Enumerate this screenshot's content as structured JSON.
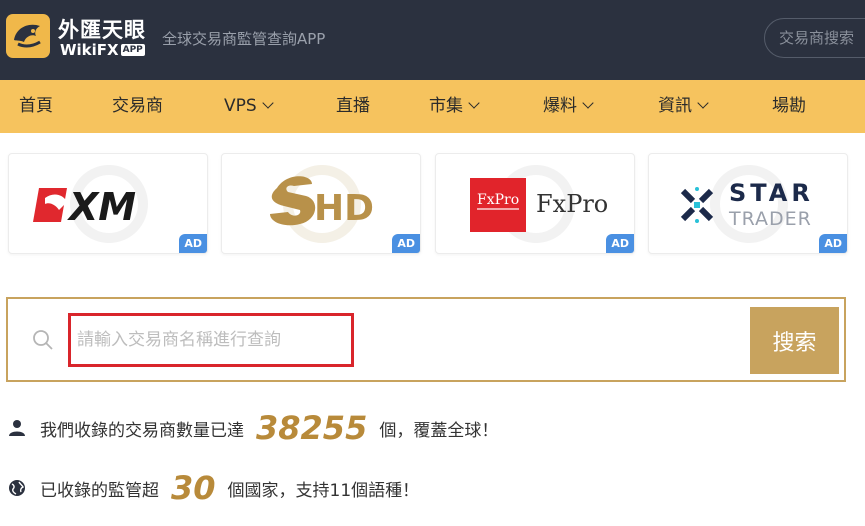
{
  "header": {
    "logo_cn": "外匯天眼",
    "logo_en": "WikiFX",
    "logo_app_badge": "APP",
    "tagline": "全球交易商監管查詢APP",
    "search_button_label": "交易商搜索"
  },
  "nav": {
    "items": [
      {
        "label": "首頁",
        "has_dropdown": false
      },
      {
        "label": "交易商",
        "has_dropdown": false
      },
      {
        "label": "VPS",
        "has_dropdown": true
      },
      {
        "label": "直播",
        "has_dropdown": false
      },
      {
        "label": "市集",
        "has_dropdown": true
      },
      {
        "label": "爆料",
        "has_dropdown": true
      },
      {
        "label": "資訊",
        "has_dropdown": true
      },
      {
        "label": "場勘",
        "has_dropdown": false
      }
    ]
  },
  "ads": [
    {
      "brand": "XM",
      "badge": "AD"
    },
    {
      "brand": "HD",
      "badge": "AD"
    },
    {
      "brand": "FxPro",
      "logo_box_text": "FxPro",
      "badge": "AD"
    },
    {
      "brand_line1": "STAR",
      "brand_line2": "TRADER",
      "badge": "AD"
    }
  ],
  "search": {
    "placeholder": "請輸入交易商名稱進行查詢",
    "button_label": "搜索"
  },
  "stats": {
    "brokers_prefix": "我們收錄的交易商數量已達",
    "brokers_count": "38255",
    "brokers_suffix": "個，覆蓋全球！",
    "regulators_prefix": "已收錄的監管超",
    "regulators_count": "30",
    "regulators_suffix": "個國家，支持11個語種！"
  },
  "colors": {
    "header_bg": "#2b313f",
    "nav_bg": "#f6c35e",
    "accent_gold": "#c8a35e",
    "highlight_red": "#d9252b",
    "ad_badge": "#4a90e2"
  }
}
